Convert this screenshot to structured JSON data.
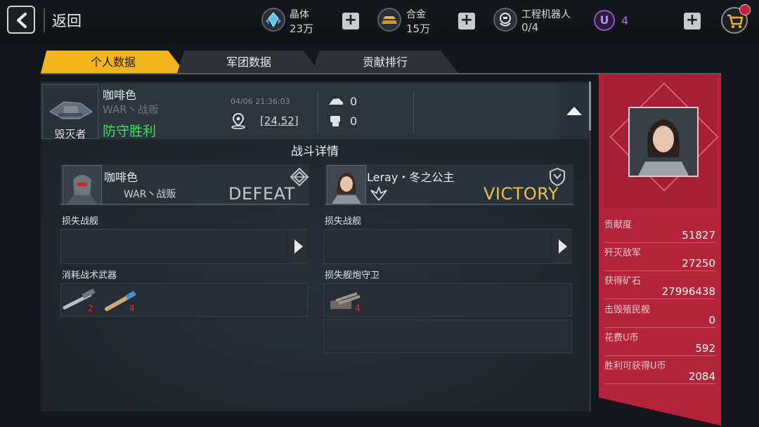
{
  "topbar": {
    "back_label": "返回",
    "crystal": {
      "name": "晶体",
      "value": "23万"
    },
    "alloy": {
      "name": "合金",
      "value": "15万"
    },
    "robot": {
      "name": "工程机器人",
      "value": "0/4"
    },
    "ucoin": {
      "symbol": "U",
      "value": "4"
    }
  },
  "tabs": [
    "个人数据",
    "军团数据",
    "贡献排行"
  ],
  "summary": {
    "ship_label": "毁灭者",
    "name": "咖啡色",
    "guild": "WAR丶战贩",
    "result": "防守胜利",
    "time": "04/06 21:36:03",
    "coord": "[24,52]",
    "count_a": "0",
    "count_b": "0"
  },
  "detail": {
    "title": "战斗详情",
    "left": {
      "name": "咖啡色",
      "guild": "WAR丶战贩",
      "outcome": "DEFEAT",
      "lost_ships_label": "损失战舰",
      "weapons_label": "消耗战术武器",
      "weapons": [
        {
          "icon": "torpedo-icon",
          "count": "2"
        },
        {
          "icon": "missile-icon",
          "count": "4"
        }
      ]
    },
    "right": {
      "name": "Leray・冬之公主",
      "outcome": "VICTORY",
      "lost_ships_label": "损失战舰",
      "turrets_label": "损失舰炮守卫",
      "turrets": [
        {
          "icon": "turret-icon",
          "count": "4"
        }
      ]
    }
  },
  "stats": [
    {
      "label": "贡献度",
      "value": "51827"
    },
    {
      "label": "歼灭敌军",
      "value": "27250"
    },
    {
      "label": "获得矿石",
      "value": "27996438"
    },
    {
      "label": "击毁殖民舰",
      "value": "0"
    },
    {
      "label": "花费U币",
      "value": "592"
    },
    {
      "label": "胜利可获得U币",
      "value": "2084"
    }
  ],
  "colors": {
    "accent": "#f2b61c",
    "victory": "#e9c24a",
    "win_text": "#3fe163",
    "panel_red": "#b3233a"
  }
}
